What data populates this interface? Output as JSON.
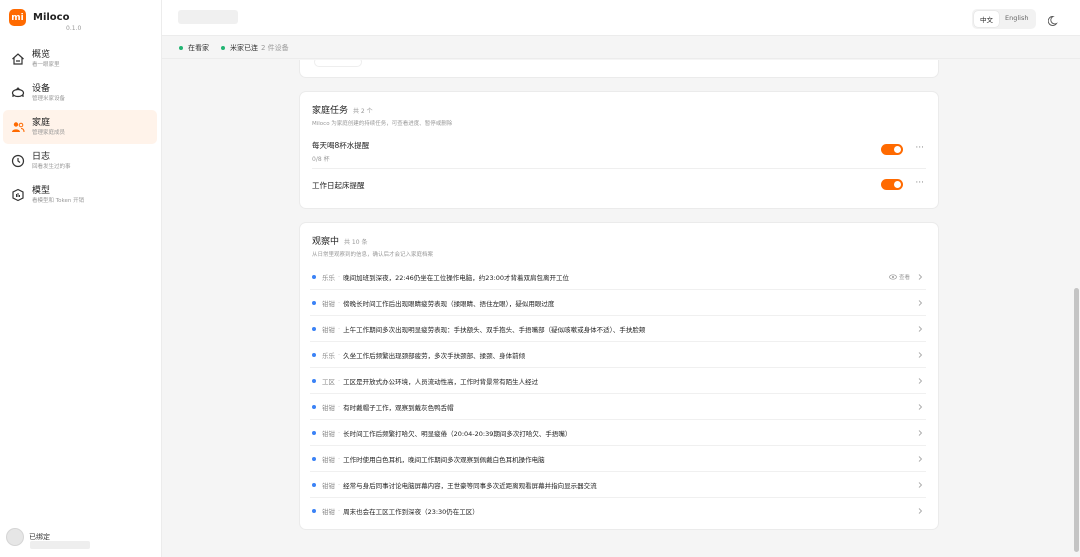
{
  "app": {
    "name": "Miloco",
    "version": "0.1.0",
    "logo_text": "mi"
  },
  "sidebar": {
    "items": [
      {
        "label": "概览",
        "sub": "看一眼家里",
        "icon": "home-icon",
        "active": false
      },
      {
        "label": "设备",
        "sub": "管理米家设备",
        "icon": "robot-icon",
        "active": false
      },
      {
        "label": "家庭",
        "sub": "管理家庭成员",
        "icon": "users-icon",
        "active": true
      },
      {
        "label": "日志",
        "sub": "回看发生过的事",
        "icon": "clock-icon",
        "active": false
      },
      {
        "label": "模型",
        "sub": "看模型和 Token 开销",
        "icon": "cube-icon",
        "active": false
      }
    ],
    "bind_status": "已绑定"
  },
  "topbar": {
    "lang_options": [
      "中文",
      "English"
    ],
    "lang_selected": "中文"
  },
  "status": {
    "watching": "在看家",
    "mijia": "米家已连",
    "device_count": "2 件设备"
  },
  "tasks_card": {
    "title": "家庭任务",
    "count": "共 2 个",
    "desc": "Miloco 为家庭创建的持续任务，可查看进度、暂停或删除",
    "items": [
      {
        "name": "每天喝8杯水提醒",
        "progress": "0/8 杯",
        "enabled": true
      },
      {
        "name": "工作日起床提醒",
        "progress": "",
        "enabled": true
      }
    ]
  },
  "obs_card": {
    "title": "观察中",
    "count": "共 10 条",
    "desc": "从日常里观察到的信息，确认后才会记入家庭档案",
    "view_label": "查看",
    "items": [
      {
        "who": "乐乐",
        "text": "晚间加班到深夜，22:46仍坐在工位操作电脑，约23:00才背着双肩包离开工位"
      },
      {
        "who": "钳钳",
        "text": "傍晚长时间工作后出现眼睛疲劳表现（揉眼睛、捂住左眼），疑似用眼过度"
      },
      {
        "who": "钳钳",
        "text": "上午工作期间多次出现明显疲劳表现：手扶额头、双手抱头、手捂嘴部（疑似咳嗽或身体不适）、手扶脸颊"
      },
      {
        "who": "乐乐",
        "text": "久坐工作后频繁出现颈部疲劳，多次手扶颈部、揉颈、身体前倾"
      },
      {
        "who": "工区",
        "text": "工区是开放式办公环境，人员流动性高，工作时背景常有陌生人经过"
      },
      {
        "who": "钳钳",
        "text": "有时戴帽子工作，观察到戴灰色鸭舌帽"
      },
      {
        "who": "钳钳",
        "text": "长时间工作后频繁打哈欠、明显疲倦（20:04-20:39期间多次打哈欠、手捂嘴）"
      },
      {
        "who": "钳钳",
        "text": "工作时使用白色耳机，晚间工作期间多次观察到佩戴白色耳机操作电脑"
      },
      {
        "who": "钳钳",
        "text": "经常与身后同事讨论电脑屏幕内容，王世豪等同事多次近距离观看屏幕并指向显示器交流"
      },
      {
        "who": "钳钳",
        "text": "周末也会在工区工作到深夜（23:30仍在工区）"
      }
    ]
  },
  "colors": {
    "accent": "#ff6a00",
    "active_bg": "#fff3ea",
    "online": "#22b573",
    "bullet": "#3b82f6"
  }
}
